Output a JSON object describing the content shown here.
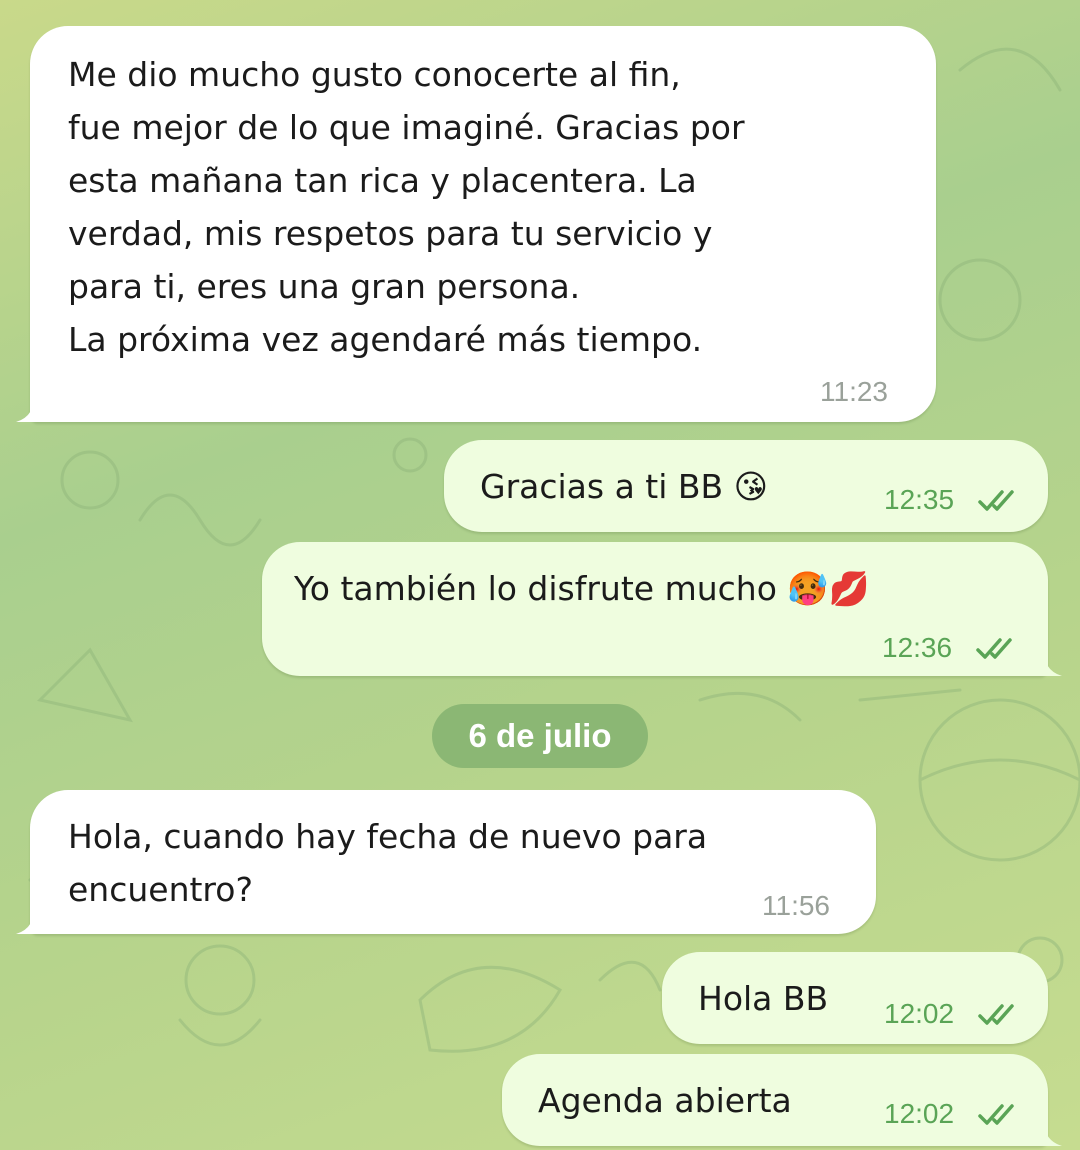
{
  "chat": {
    "date_separator": "6 de julio",
    "messages": [
      {
        "direction": "incoming",
        "text": "Me dio mucho gusto conocerte al fin,\nfue mejor de lo que imaginé. Gracias por\nesta mañana tan rica y placentera. La\nverdad, mis respetos para tu servicio y\npara ti, eres una gran persona.\nLa próxima vez agendaré más tiempo.",
        "time": "11:23"
      },
      {
        "direction": "outgoing",
        "text": "Gracias a ti BB 😘",
        "time": "12:35",
        "status": "read"
      },
      {
        "direction": "outgoing",
        "text": "Yo también lo disfrute mucho 🥵💋",
        "time": "12:36",
        "status": "read"
      },
      {
        "direction": "incoming",
        "text": "Hola, cuando hay fecha de nuevo para\nencuentro?",
        "time": "11:56"
      },
      {
        "direction": "outgoing",
        "text": "Hola BB",
        "time": "12:02",
        "status": "read"
      },
      {
        "direction": "outgoing",
        "text": "Agenda abierta",
        "time": "12:02",
        "status": "read"
      }
    ]
  },
  "colors": {
    "incoming_bubble": "#ffffff",
    "outgoing_bubble": "#effddf",
    "read_ticks": "#5aa456",
    "date_pill": "#8bb774"
  },
  "icons": {
    "read_receipt": "double-check-icon"
  }
}
